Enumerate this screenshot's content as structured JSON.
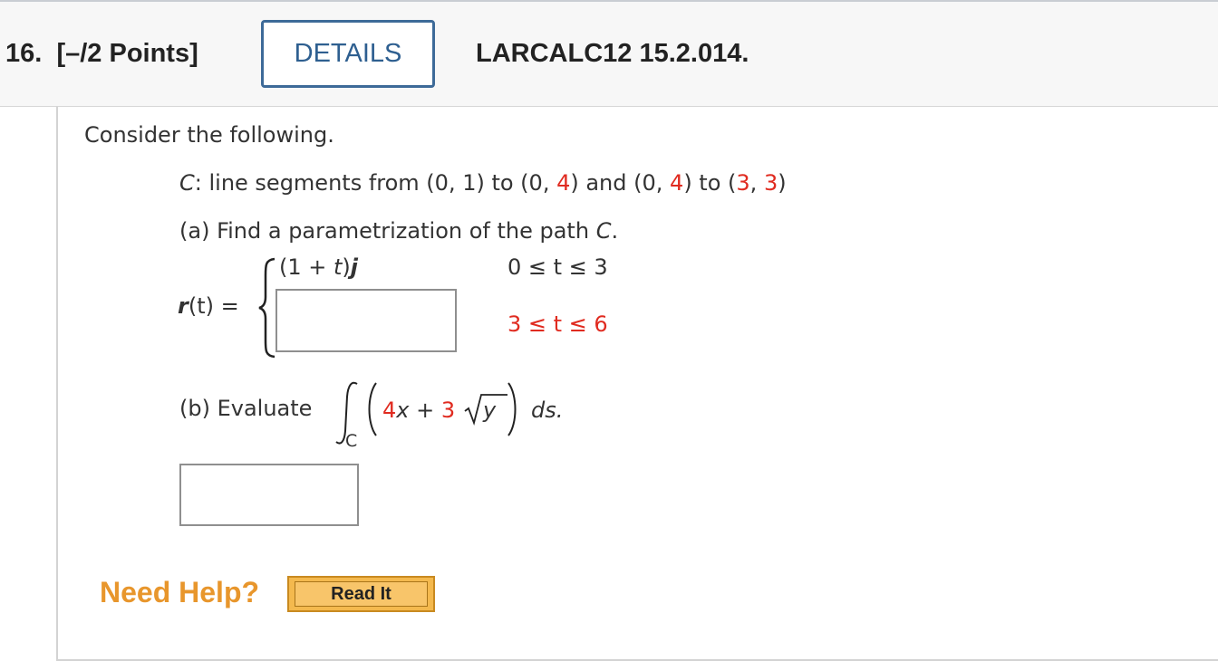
{
  "header": {
    "question_number": "16.",
    "points": "[–/2 Points]",
    "details_label": "DETAILS",
    "question_code": "LARCALC12 15.2.014."
  },
  "problem": {
    "intro": "Consider the following.",
    "curve": {
      "label": "C",
      "text_prefix": ": line segments from (0, 1) to (0, ",
      "v1": "4",
      "text_mid1": ") and (0, ",
      "v2": "4",
      "text_mid2": ") to (",
      "v3": "3",
      "comma": ", ",
      "v4": "3",
      "text_end": ")"
    },
    "part_a": {
      "prompt_prefix": "(a) Find a parametrization of the path ",
      "prompt_var": "C",
      "prompt_end": ".",
      "lhs_r": "r",
      "lhs_rest": "(t) =",
      "piece1_expr_a": "(1 + ",
      "piece1_expr_t": "t",
      "piece1_expr_b": ")",
      "piece1_expr_j": "j",
      "piece1_domain": "0 ≤ t ≤ 3",
      "piece2_value": "",
      "piece2_domain": "3 ≤ t ≤ 6"
    },
    "part_b": {
      "prompt": "(b) Evaluate",
      "integral_sub": "C",
      "coef1": "4",
      "var1": "x",
      "plus": " + ",
      "coef2": "3",
      "var2": "y",
      "ds": "ds.",
      "answer_value": ""
    }
  },
  "help": {
    "label": "Need Help?",
    "read_it_label": "Read It"
  },
  "colors": {
    "red": "#e02b20",
    "details_blue": "#3d6a98",
    "help_orange": "#e8962c",
    "read_it_bg": "#f4b94e"
  }
}
